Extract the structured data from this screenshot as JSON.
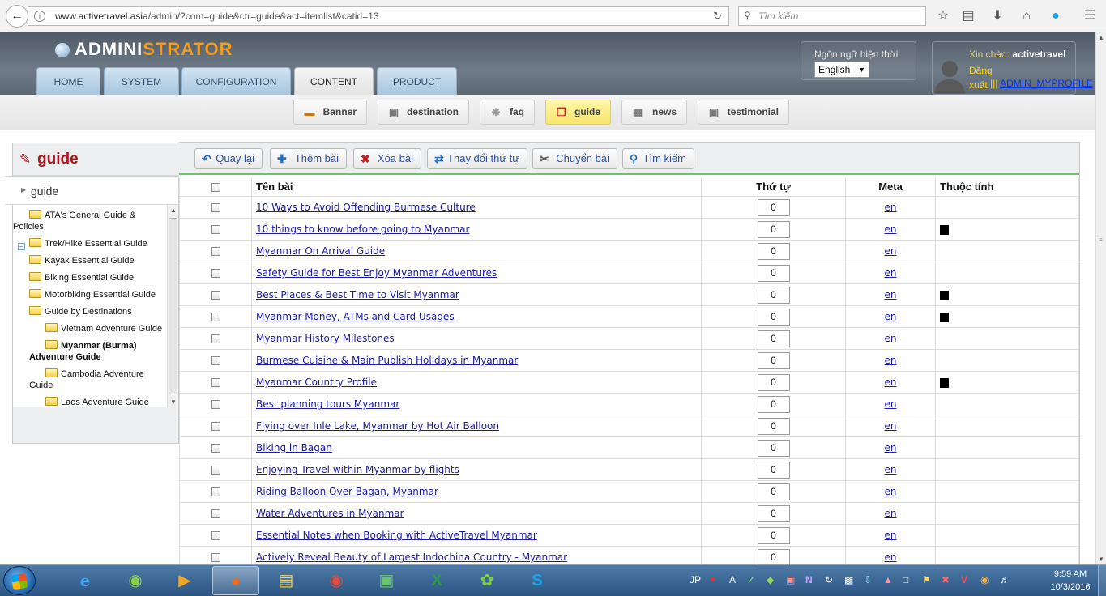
{
  "browser": {
    "url_host": "www.activetravel.asia",
    "url_path": "/admin/?com=guide&ctr=guide&act=itemlist&catid=13",
    "search_placeholder": "Tìm kiếm"
  },
  "admin": {
    "logo_part1": "ADMINI",
    "logo_part2": "STRATOR",
    "tabs": [
      {
        "label": "HOME"
      },
      {
        "label": "SYSTEM"
      },
      {
        "label": "CONFIGURATION"
      },
      {
        "label": "CONTENT",
        "active": true
      },
      {
        "label": "PRODUCT"
      }
    ],
    "language_label": "Ngôn ngữ hiện thời",
    "language_value": "English",
    "greeting": "Xin chào:",
    "username": "activetravel",
    "logout": "Đăng xuất",
    "separator": "|||",
    "myprofile": "ADMIN_MYPROFILE"
  },
  "subnav": [
    {
      "label": "Banner",
      "icon": "banner-icon"
    },
    {
      "label": "destination",
      "icon": "destination-icon"
    },
    {
      "label": "faq",
      "icon": "faq-icon"
    },
    {
      "label": "guide",
      "icon": "guide-icon",
      "active": true
    },
    {
      "label": "news",
      "icon": "news-icon"
    },
    {
      "label": "testimonial",
      "icon": "testimonial-icon"
    }
  ],
  "sidebar": {
    "title": "guide",
    "root": "guide",
    "tree": [
      {
        "label": "ATA's General Guide & Policies"
      },
      {
        "label": "Trek/Hike Essential Guide"
      },
      {
        "label": "Kayak Essential Guide"
      },
      {
        "label": "Biking Essential Guide"
      },
      {
        "label": "Motorbiking Essential Guide"
      },
      {
        "label": "Guide by Destinations",
        "expanded": true
      },
      {
        "label": "Vietnam Adventure Guide"
      },
      {
        "label": "Myanmar (Burma) Adventure Guide",
        "selected": true
      },
      {
        "label": "Cambodia Adventure Guide"
      },
      {
        "label": "Laos Adventure Guide"
      }
    ]
  },
  "toolbar": {
    "back": "Quay lại",
    "add": "Thêm bài",
    "delete": "Xóa bài",
    "reorder": "Thay đổi thứ tự",
    "move": "Chuyển bài",
    "search": "Tìm kiếm"
  },
  "table": {
    "headers": {
      "name": "Tên bài",
      "order": "Thứ tự",
      "meta": "Meta",
      "attr": "Thuộc tính"
    },
    "rows": [
      {
        "name": "10 Ways to Avoid Offending Burmese Culture",
        "order": "0",
        "meta": "en",
        "attr": false
      },
      {
        "name": "10 things to know before going to Myanmar",
        "order": "0",
        "meta": "en",
        "attr": true
      },
      {
        "name": "Myanmar On Arrival Guide",
        "order": "0",
        "meta": "en",
        "attr": false
      },
      {
        "name": "Safety Guide for Best Enjoy Myanmar Adventures",
        "order": "0",
        "meta": "en",
        "attr": false
      },
      {
        "name": "Best Places & Best Time to Visit Myanmar",
        "order": "0",
        "meta": "en",
        "attr": true
      },
      {
        "name": "Myanmar Money, ATMs and Card Usages",
        "order": "0",
        "meta": "en",
        "attr": true
      },
      {
        "name": "Myanmar History Milestones",
        "order": "0",
        "meta": "en",
        "attr": false
      },
      {
        "name": "Burmese Cuisine & Main Publish Holidays in Myanmar",
        "order": "0",
        "meta": "en",
        "attr": false
      },
      {
        "name": "Myanmar Country Profile",
        "order": "0",
        "meta": "en",
        "attr": true
      },
      {
        "name": "Best planning tours Myanmar",
        "order": "0",
        "meta": "en",
        "attr": false
      },
      {
        "name": "Flying over Inle Lake, Myanmar by Hot Air Balloon",
        "order": "0",
        "meta": "en",
        "attr": false
      },
      {
        "name": "Biking in Bagan",
        "order": "0",
        "meta": "en",
        "attr": false
      },
      {
        "name": "Enjoying Travel within Myanmar by flights",
        "order": "0",
        "meta": "en",
        "attr": false
      },
      {
        "name": "Riding Balloon Over Bagan, Myanmar",
        "order": "0",
        "meta": "en",
        "attr": false
      },
      {
        "name": "Water Adventures in Myanmar",
        "order": "0",
        "meta": "en",
        "attr": false
      },
      {
        "name": "Essential Notes when Booking with ActiveTravel Myanmar",
        "order": "0",
        "meta": "en",
        "attr": false
      },
      {
        "name": "Actively Reveal Beauty of Largest Indochina Country - Myanmar",
        "order": "0",
        "meta": "en",
        "attr": false
      }
    ]
  },
  "taskbar": {
    "lang": "JP",
    "time": "9:59 AM",
    "date": "10/3/2016"
  }
}
